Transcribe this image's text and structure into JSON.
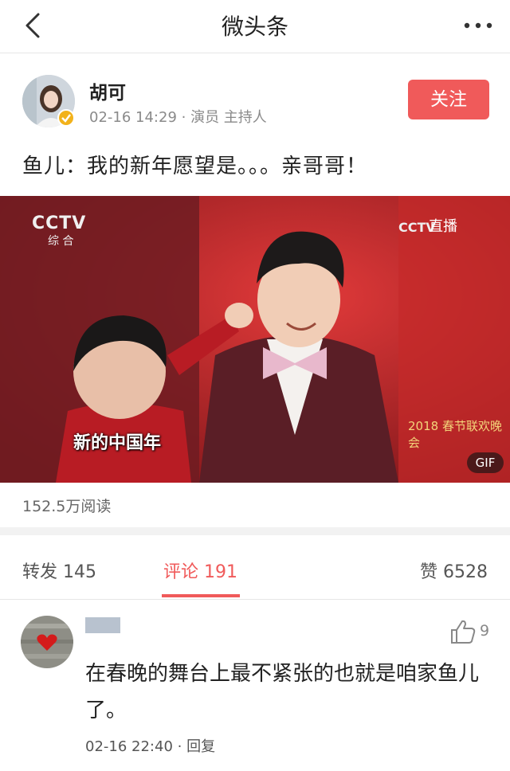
{
  "header": {
    "title": "微头条",
    "back_icon": "chevron-left-icon",
    "more_icon": "more-dots-icon"
  },
  "author": {
    "name": "胡可",
    "meta": "02-16 14:29 · 演员 主持人",
    "follow_label": "关注",
    "follow_color": "#f05a5a",
    "verified_color": "#f2b21b"
  },
  "post": {
    "text": "鱼儿：我的新年愿望是。。。亲哥哥！"
  },
  "media": {
    "logo": "CCTV",
    "logo_sub": "综 合",
    "corner_logo": "CCTV",
    "live_label": "直播",
    "caption": "新的中国年",
    "gala_mark": "2018 春节联欢晚会",
    "badge": "GIF"
  },
  "stats": {
    "reads": "152.5万阅读"
  },
  "tabs": [
    {
      "label": "转发 145",
      "active": false
    },
    {
      "label": "评论 191",
      "active": true
    },
    {
      "label": "赞 6528",
      "active": false
    }
  ],
  "comments": [
    {
      "text": "在春晚的舞台上最不紧张的也就是咱家鱼儿了。",
      "likes": "9",
      "time": "02-16 22:40",
      "reply_label": "回复"
    }
  ],
  "colors": {
    "accent": "#f05a5a",
    "divider": "#e6e6e6",
    "muted": "#8a8a8a"
  }
}
